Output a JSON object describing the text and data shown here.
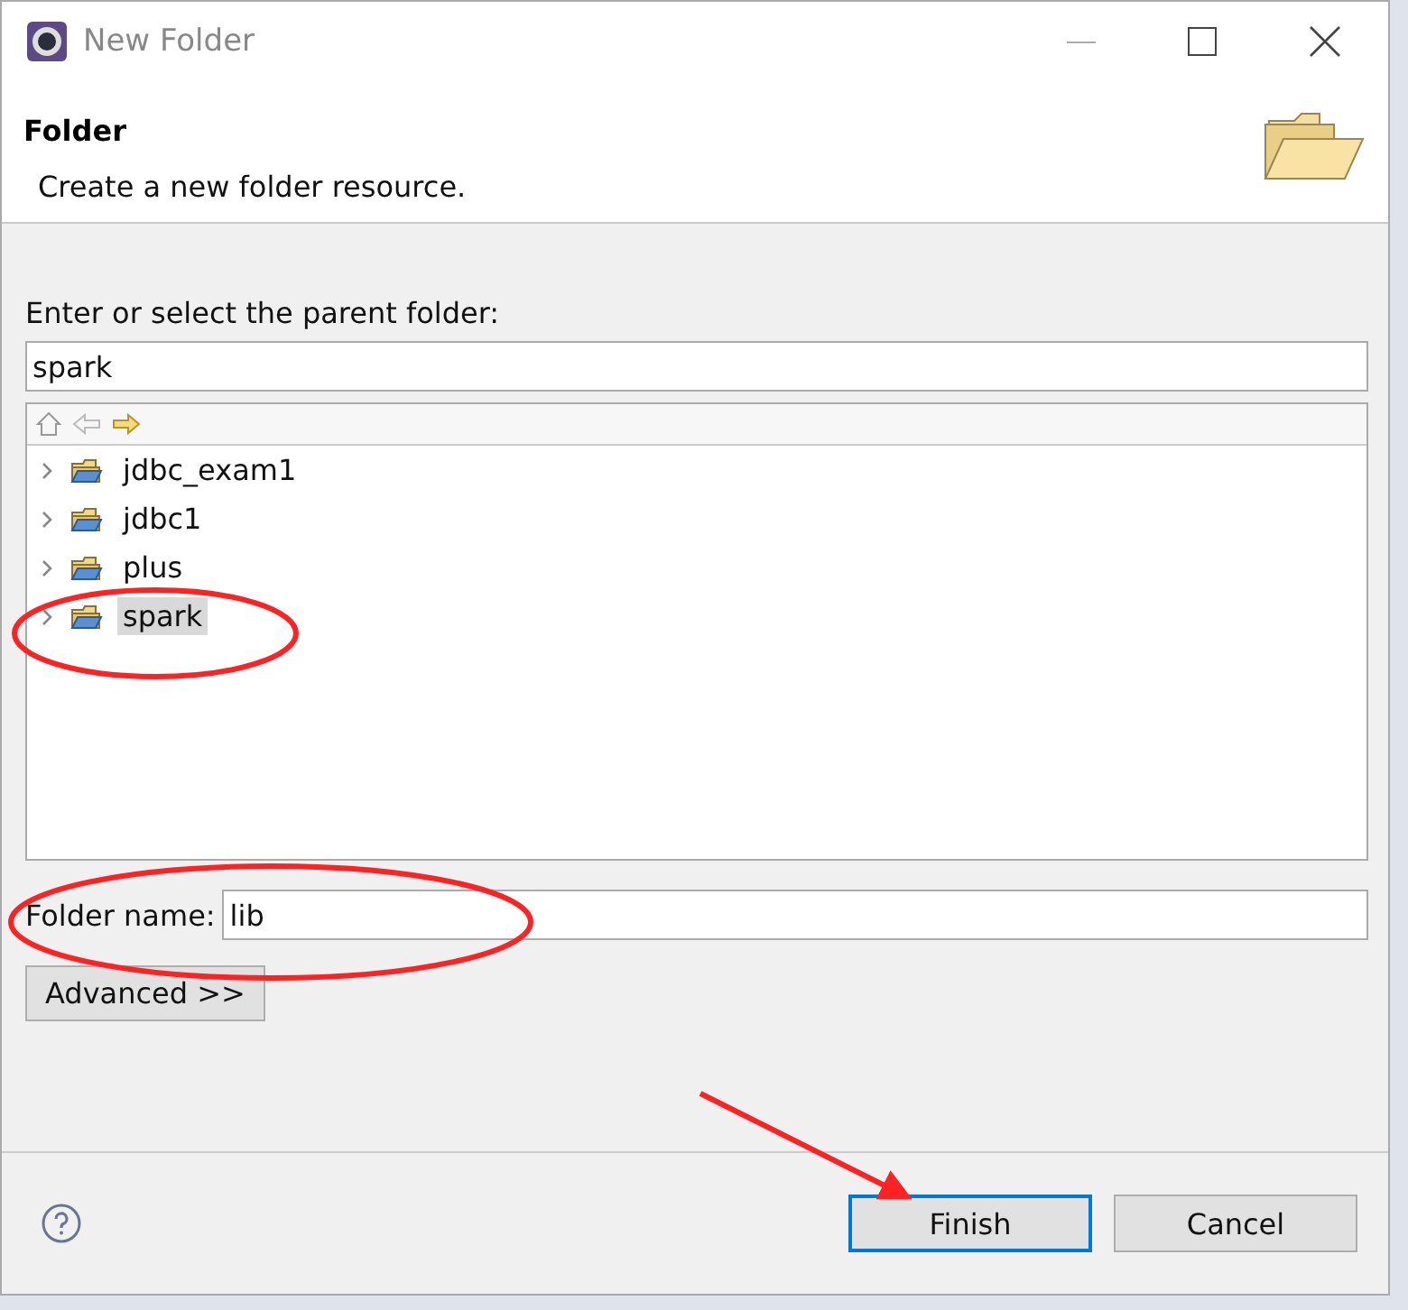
{
  "window": {
    "title": "New Folder"
  },
  "header": {
    "title": "Folder",
    "description": "Create a new folder resource."
  },
  "parent_folder": {
    "label": "Enter or select the parent folder:",
    "value": "spark"
  },
  "tree": {
    "items": [
      {
        "label": "jdbc_exam1",
        "expanded": false,
        "selected": false
      },
      {
        "label": "jdbc1",
        "expanded": false,
        "selected": false
      },
      {
        "label": "plus",
        "expanded": false,
        "selected": false
      },
      {
        "label": "spark",
        "expanded": false,
        "selected": true
      }
    ]
  },
  "folder_name": {
    "label": "Folder name:",
    "value": "lib"
  },
  "advanced_button": "Advanced >>",
  "buttons": [
    {
      "label": "Finish",
      "default": true
    },
    {
      "label": "Cancel",
      "default": false
    }
  ]
}
